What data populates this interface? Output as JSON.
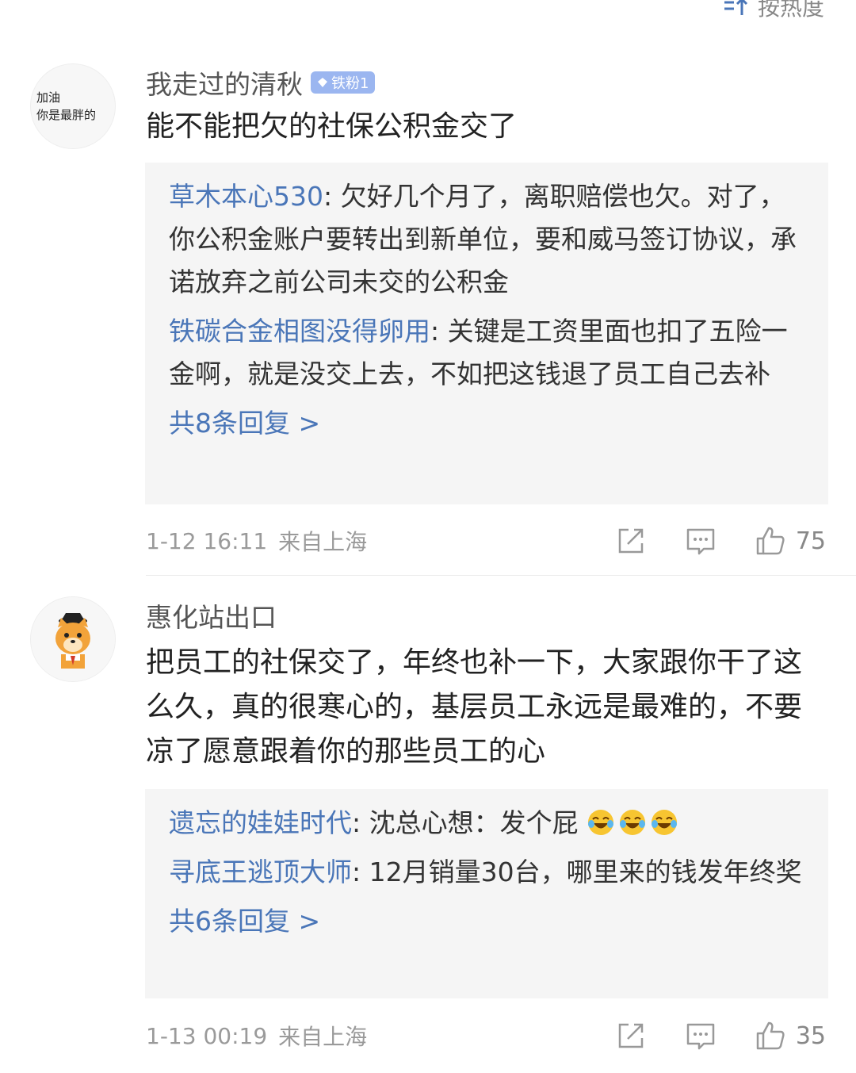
{
  "sort": {
    "label": "按热度",
    "icon": "sort-icon"
  },
  "comments": [
    {
      "avatar_text": [
        "加油",
        "你是最胖的"
      ],
      "username": "我走过的清秋",
      "badge": "铁粉1",
      "content": "能不能把欠的社保公积金交了",
      "replies": [
        {
          "author": "草木本心530",
          "text": "欠好几个月了，离职赔偿也欠。对了，你公积金账户要转出到新单位，要和威马签订协议，承诺放弃之前公司未交的公积金"
        },
        {
          "author": "铁碳合金相图没得卵用",
          "text": "关键是工资里面也扣了五险一金啊，就是没交上去，不如把这钱退了员工自己去补"
        }
      ],
      "more_replies": "共8条回复 >",
      "time": "1-12 16:11",
      "location": "来自上海",
      "likes": "75"
    },
    {
      "username": "惠化站出口",
      "content": "把员工的社保交了，年终也补一下，大家跟你干了这么久，真的很寒心的，基层员工永远是最难的，不要凉了愿意跟着你的那些员工的心",
      "replies": [
        {
          "author": "遗忘的娃娃时代",
          "text": "沈总心想：发个屁",
          "emoji_count": 3
        },
        {
          "author": "寻底王逃顶大师",
          "text": "12月销量30台，哪里来的钱发年终奖"
        }
      ],
      "more_replies": "共6条回复 >",
      "time": "1-13 00:19",
      "location": "来自上海",
      "likes": "35"
    }
  ],
  "colors": {
    "link": "#4a76b8",
    "reply_bg": "#f5f5f5",
    "meta": "#9a9a9a",
    "badge": "#9bb6f0"
  }
}
